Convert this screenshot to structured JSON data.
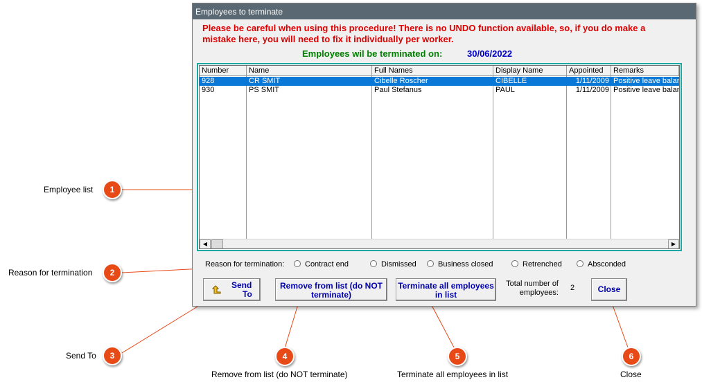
{
  "dialog": {
    "title": "Employees to terminate",
    "warning": "Please be careful when using this procedure! There is no UNDO function available, so, if you do make a mistake here, you will need to fix it individually per worker.",
    "termination_label": "Employees wil be terminated on:",
    "termination_date": "30/06/2022"
  },
  "list": {
    "columns": [
      "Number",
      "Name",
      "Full Names",
      "Display Name",
      "Appointed",
      "Remarks"
    ],
    "rows": [
      {
        "number": "928",
        "name": "CR SMIT",
        "full_names": "Cibelle Roscher",
        "display_name": "CIBELLE",
        "appointed": "1/11/2009",
        "remarks": "Positive leave balance",
        "selected": true
      },
      {
        "number": "930",
        "name": "PS SMIT",
        "full_names": "Paul Stefanus",
        "display_name": "PAUL",
        "appointed": "1/11/2009",
        "remarks": "Positive leave balance",
        "selected": false
      }
    ]
  },
  "reason": {
    "label": "Reason for termination:",
    "options": [
      "Contract end",
      "Dismissed",
      "Business closed",
      "Retrenched",
      "Absconded"
    ]
  },
  "buttons": {
    "send_to_line1": "Send",
    "send_to_line2": "To",
    "remove_line1": "Remove from list (do NOT",
    "remove_line2": "terminate)",
    "terminate_line1": "Terminate all employees",
    "terminate_line2": "in list",
    "close": "Close"
  },
  "total": {
    "label_line1": "Total number of",
    "label_line2": "employees:",
    "value": "2"
  },
  "callouts": [
    {
      "number": "1",
      "label": "Employee list"
    },
    {
      "number": "2",
      "label": "Reason for termination"
    },
    {
      "number": "3",
      "label": "Send To"
    },
    {
      "number": "4",
      "label": "Remove from list (do NOT terminate)"
    },
    {
      "number": "5",
      "label": "Terminate all employees in list"
    },
    {
      "number": "6",
      "label": "Close"
    }
  ],
  "colors": {
    "callout": "#e84a17",
    "warning": "#e00000",
    "termination_label": "#008000",
    "termination_date": "#0000c8",
    "selection": "#0a78d7",
    "button_text": "#0000b0"
  }
}
